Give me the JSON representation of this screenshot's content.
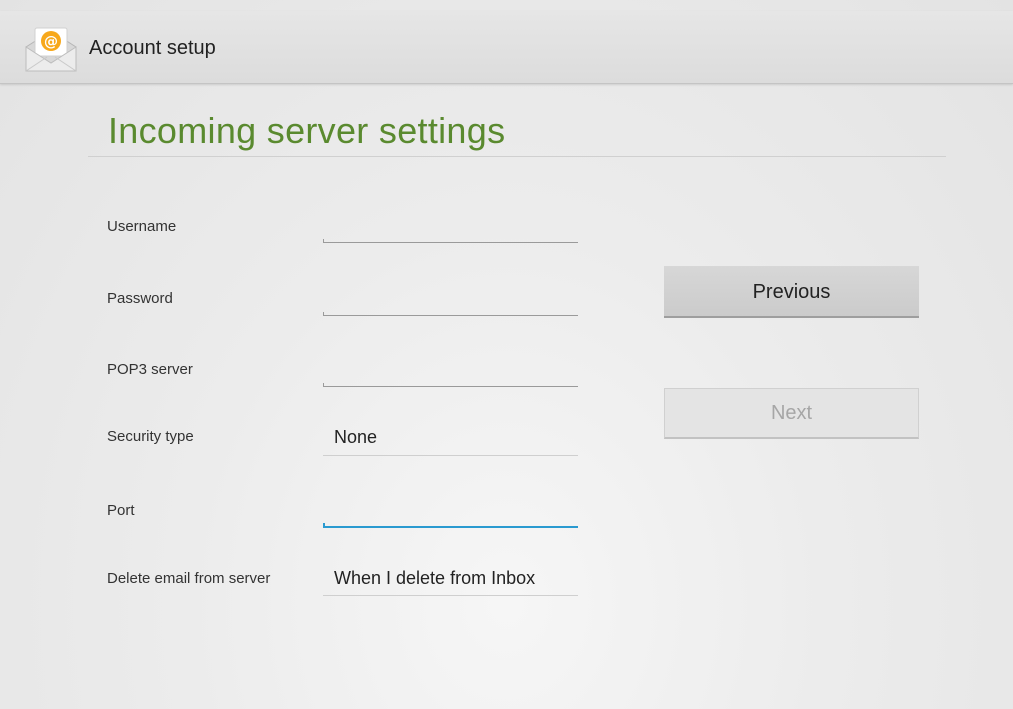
{
  "header": {
    "app_title": "Account setup",
    "app_icon": "email-envelope-at-icon"
  },
  "page": {
    "title": "Incoming server settings"
  },
  "form": {
    "username": {
      "label": "Username",
      "value": ""
    },
    "password": {
      "label": "Password",
      "value": ""
    },
    "pop3_server": {
      "label": "POP3 server",
      "value": ""
    },
    "security_type": {
      "label": "Security type",
      "value": "None"
    },
    "port": {
      "label": "Port",
      "value": ""
    },
    "delete_email": {
      "label": "Delete email from server",
      "value": "When I delete from Inbox"
    }
  },
  "buttons": {
    "previous": "Previous",
    "next": "Next"
  },
  "colors": {
    "heading": "#5a8a2f",
    "focus_accent": "#2a9ad0",
    "disabled_text": "#a6a6a6"
  }
}
